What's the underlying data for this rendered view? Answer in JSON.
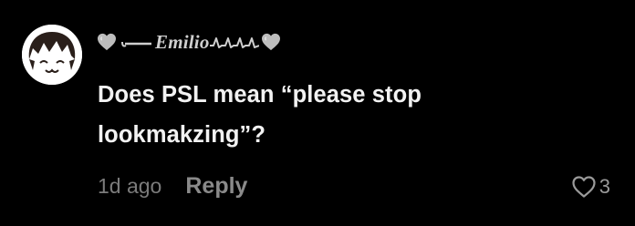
{
  "comment": {
    "username": "Emilio",
    "text_line1": "Does PSL mean “please stop",
    "text_line2": "lookmakzing”?",
    "timestamp": "1d ago",
    "reply_label": "Reply",
    "like_count": "3",
    "icons": {
      "avatar": "cartoon-face-avatar",
      "username_decoration": "gray-heart-icon",
      "like": "heart-outline-icon"
    }
  }
}
